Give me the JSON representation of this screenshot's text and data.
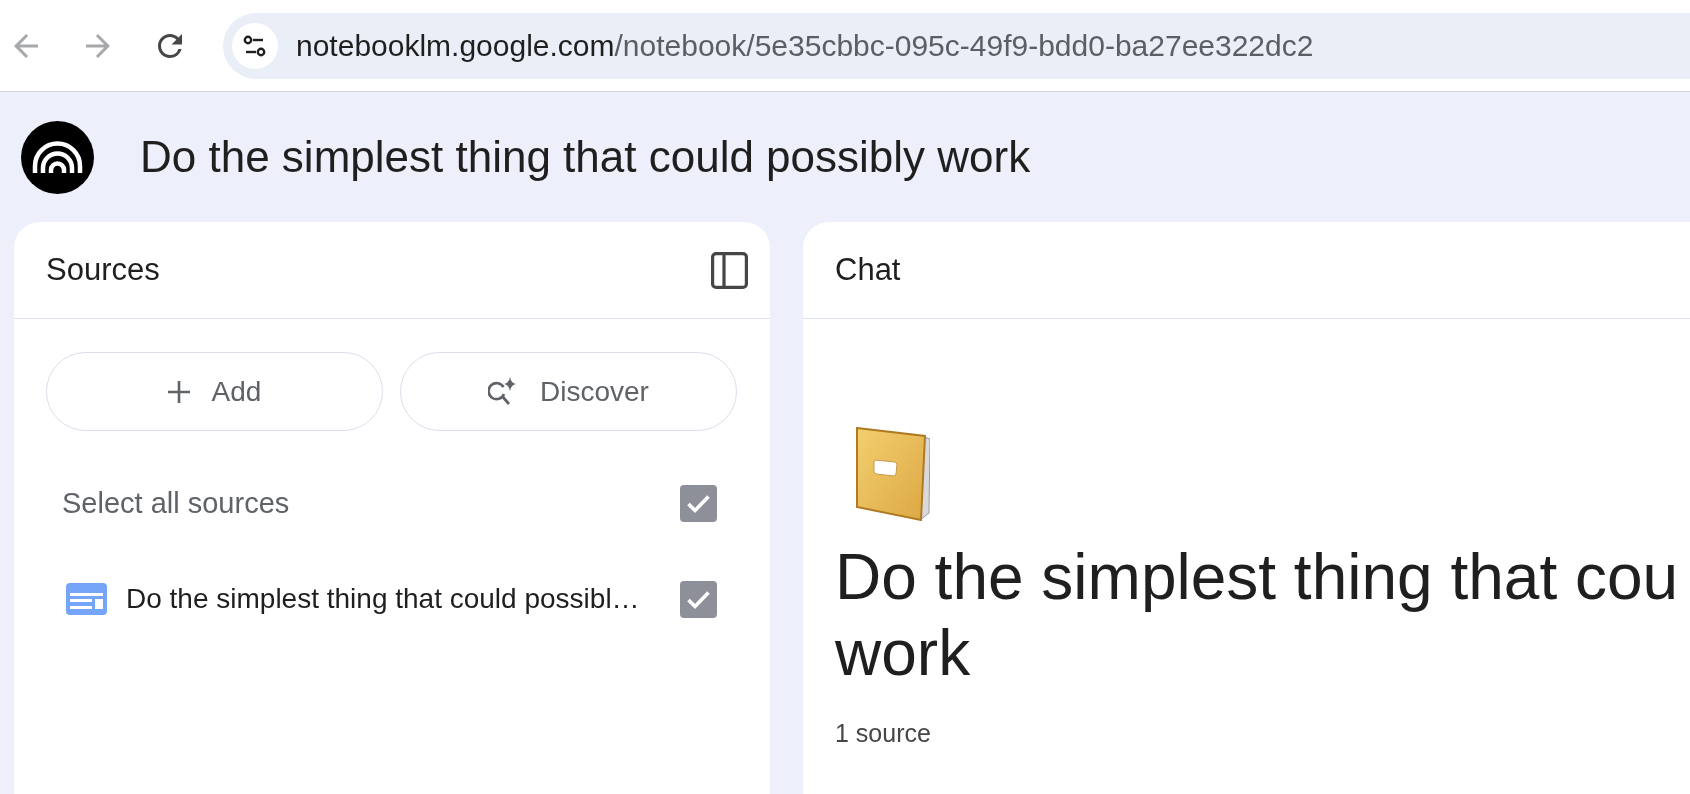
{
  "browser": {
    "nav": [
      {
        "kind": "back",
        "disabled": true
      },
      {
        "kind": "forward",
        "disabled": true
      },
      {
        "kind": "reload",
        "disabled": false
      }
    ],
    "address": {
      "host": "notebooklm.google.com",
      "path": "/notebook/5e35cbbc-095c-49f9-bdd0-ba27ee322dc2"
    }
  },
  "notebook": {
    "title": "Do the simplest thing that could possibly work"
  },
  "sources": {
    "title": "Sources",
    "actions": [
      {
        "kind": "add",
        "label": "Add"
      },
      {
        "kind": "discover",
        "label": "Discover"
      }
    ],
    "select_all": {
      "label": "Select all sources",
      "checked": true
    },
    "items": [
      {
        "label": "Do the simplest thing that could possibl…",
        "checked": true
      }
    ]
  },
  "chat": {
    "title": "Chat",
    "heading_lines": [
      "Do the simplest thing that cou",
      "work"
    ],
    "source_count": "1 source"
  }
}
